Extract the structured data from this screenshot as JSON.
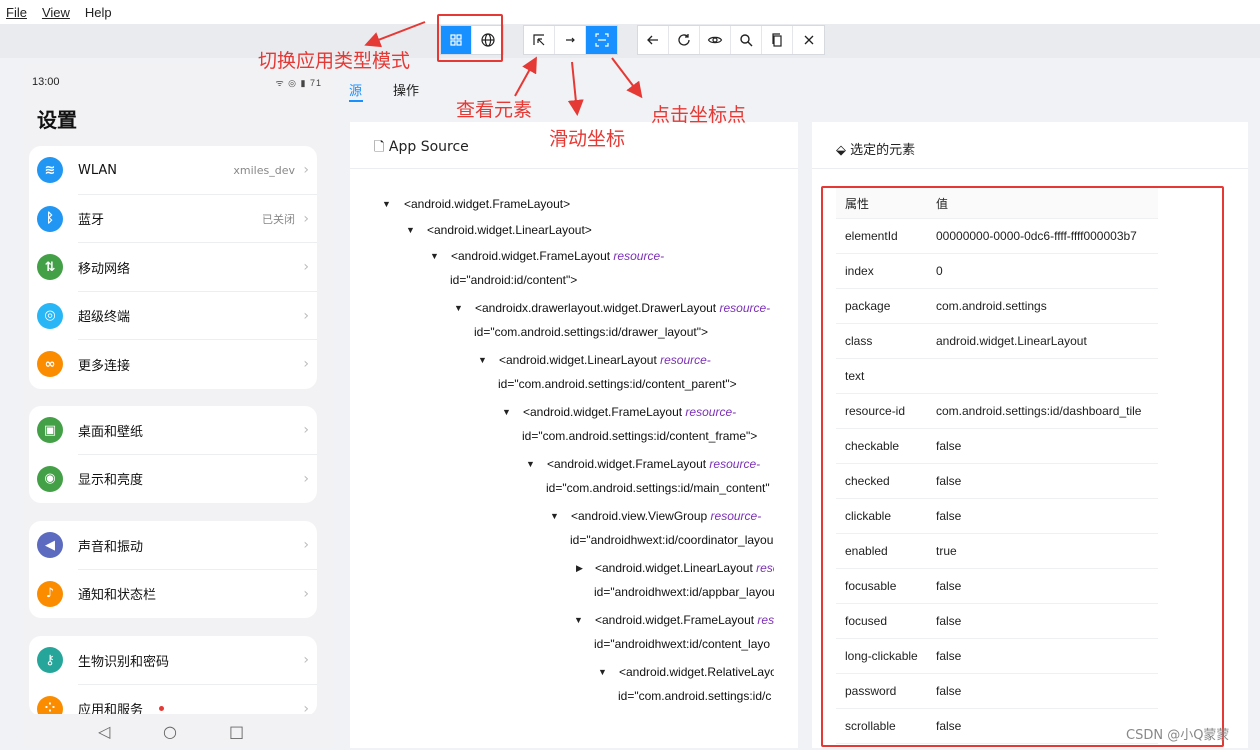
{
  "menu": {
    "file": "File",
    "view": "View",
    "help": "Help"
  },
  "device": {
    "time": "13:00",
    "status_icons": "ᯤ ◎ ▮ 71",
    "title": "设置",
    "cards": [
      [
        {
          "label": "WLAN",
          "value": "xmiles_dev",
          "icon": "wifi-icon",
          "color": "#2196f3",
          "glyph": "≋"
        },
        {
          "label": "蓝牙",
          "value": "已关闭",
          "icon": "bluetooth-icon",
          "color": "#2196f3",
          "glyph": "ᛒ"
        },
        {
          "label": "移动网络",
          "value": "",
          "icon": "mobile-data-icon",
          "color": "#43a047",
          "glyph": "⇅"
        },
        {
          "label": "超级终端",
          "value": "",
          "icon": "super-device-icon",
          "color": "#29b6f6",
          "glyph": "◎"
        },
        {
          "label": "更多连接",
          "value": "",
          "icon": "link-icon",
          "color": "#fb8c00",
          "glyph": "∞"
        }
      ],
      [
        {
          "label": "桌面和壁纸",
          "value": "",
          "icon": "wallpaper-icon",
          "color": "#43a047",
          "glyph": "▣"
        },
        {
          "label": "显示和亮度",
          "value": "",
          "icon": "display-icon",
          "color": "#43a047",
          "glyph": "◉"
        }
      ],
      [
        {
          "label": "声音和振动",
          "value": "",
          "icon": "sound-icon",
          "color": "#5c6bc0",
          "glyph": "◀"
        },
        {
          "label": "通知和状态栏",
          "value": "",
          "icon": "notification-icon",
          "color": "#fb8c00",
          "glyph": "♪"
        }
      ],
      [
        {
          "label": "生物识别和密码",
          "value": "",
          "icon": "key-icon",
          "color": "#26a69a",
          "glyph": "⚷"
        },
        {
          "label": "应用和服务",
          "value": "",
          "icon": "apps-icon",
          "color": "#fb8c00",
          "glyph": "⁘"
        }
      ]
    ]
  },
  "tabs": {
    "source": "源",
    "actions": "操作"
  },
  "source_panel": {
    "title": "App Source",
    "nodes": [
      {
        "tag": "<android.widget.FrameLayout>",
        "attr": "",
        "line2": ""
      },
      {
        "tag": "<android.widget.LinearLayout>",
        "attr": "",
        "line2": ""
      },
      {
        "tag": "<android.widget.FrameLayout",
        "attr": " resource-",
        "line2": "id=\"android:id/content\">"
      },
      {
        "tag": "<androidx.drawerlayout.widget.DrawerLayout",
        "attr": " resource-",
        "line2": "id=\"com.android.settings:id/drawer_layout\">"
      },
      {
        "tag": "<android.widget.LinearLayout",
        "attr": " resource-",
        "line2": "id=\"com.android.settings:id/content_parent\">"
      },
      {
        "tag": "<android.widget.FrameLayout",
        "attr": " resource-",
        "line2": "id=\"com.android.settings:id/content_frame\">"
      },
      {
        "tag": "<android.widget.FrameLayout",
        "attr": " resource-",
        "line2": "id=\"com.android.settings:id/main_content\""
      },
      {
        "tag": "<android.view.ViewGroup",
        "attr": " resource-",
        "line2": "id=\"androidhwext:id/coordinator_layou"
      },
      {
        "tag": "<android.widget.LinearLayout",
        "attr": " reso",
        "line2": "id=\"androidhwext:id/appbar_layou"
      },
      {
        "tag": "<android.widget.FrameLayout",
        "attr": " reso",
        "line2": "id=\"androidhwext:id/content_layo"
      },
      {
        "tag": "<android.widget.RelativeLayo",
        "attr": "",
        "line2": "id=\"com.android.settings:id/c"
      }
    ]
  },
  "selected_panel": {
    "title": "选定的元素",
    "header": {
      "key": "属性",
      "value": "值"
    },
    "rows": [
      {
        "key": "elementId",
        "value": "00000000-0000-0dc6-ffff-ffff000003b7"
      },
      {
        "key": "index",
        "value": "0"
      },
      {
        "key": "package",
        "value": "com.android.settings"
      },
      {
        "key": "class",
        "value": "android.widget.LinearLayout"
      },
      {
        "key": "text",
        "value": ""
      },
      {
        "key": "resource-id",
        "value": "com.android.settings:id/dashboard_tile"
      },
      {
        "key": "checkable",
        "value": "false"
      },
      {
        "key": "checked",
        "value": "false"
      },
      {
        "key": "clickable",
        "value": "false"
      },
      {
        "key": "enabled",
        "value": "true"
      },
      {
        "key": "focusable",
        "value": "false"
      },
      {
        "key": "focused",
        "value": "false"
      },
      {
        "key": "long-clickable",
        "value": "false"
      },
      {
        "key": "password",
        "value": "false"
      },
      {
        "key": "scrollable",
        "value": "false"
      }
    ]
  },
  "annotations": {
    "mode": "切换应用类型模式",
    "inspect": "查看元素",
    "swipe": "滑动坐标",
    "tap": "点击坐标点"
  },
  "watermark": "CSDN @小Q蒙蒙",
  "colors": {
    "accent": "#1890ff",
    "annotation": "#e53935"
  }
}
